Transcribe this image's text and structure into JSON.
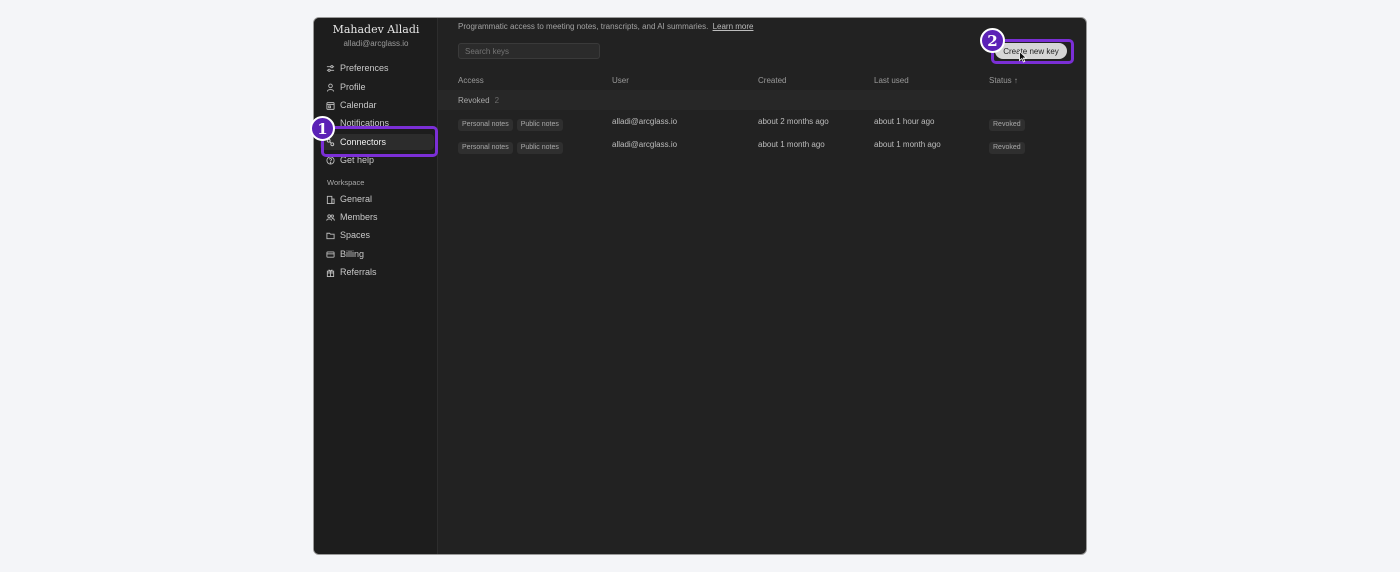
{
  "user": {
    "name": "Mahadev Alladi",
    "email": "alladi@arcglass.io"
  },
  "sidebar": {
    "account_items": [
      {
        "label": "Preferences",
        "icon": "sliders-icon"
      },
      {
        "label": "Profile",
        "icon": "user-icon"
      },
      {
        "label": "Calendar",
        "icon": "calendar-icon"
      },
      {
        "label": "Notifications",
        "icon": "bell-icon"
      },
      {
        "label": "Connectors",
        "icon": "connectors-icon",
        "active": true
      },
      {
        "label": "Get help",
        "icon": "help-icon"
      }
    ],
    "workspace_label": "Workspace",
    "workspace_items": [
      {
        "label": "General",
        "icon": "building-icon"
      },
      {
        "label": "Members",
        "icon": "members-icon"
      },
      {
        "label": "Spaces",
        "icon": "folder-icon"
      },
      {
        "label": "Billing",
        "icon": "card-icon"
      },
      {
        "label": "Referrals",
        "icon": "gift-icon"
      }
    ]
  },
  "main": {
    "intro_text": "Programmatic access to meeting notes, transcripts, and AI summaries.",
    "learn_more": "Learn more",
    "search_placeholder": "Search keys",
    "create_button": "Create new key",
    "columns": {
      "access": "Access",
      "user": "User",
      "created": "Created",
      "last_used": "Last used",
      "status": "Status ↑"
    },
    "group": {
      "label": "Revoked",
      "count": "2"
    },
    "rows": [
      {
        "tags": [
          "Personal notes",
          "Public notes"
        ],
        "user": "alladi@arcglass.io",
        "created": "about 2 months ago",
        "last_used": "about 1 hour ago",
        "status": "Revoked"
      },
      {
        "tags": [
          "Personal notes",
          "Public notes"
        ],
        "user": "alladi@arcglass.io",
        "created": "about 1 month ago",
        "last_used": "about 1 month ago",
        "status": "Revoked"
      }
    ]
  },
  "annotations": {
    "marker_1": "1",
    "marker_2": "2"
  },
  "colors": {
    "highlight": "#7b2fd6",
    "marker_fill": "#5b21b6",
    "window_bg": "#222222",
    "page_bg": "#f4f5f8"
  }
}
